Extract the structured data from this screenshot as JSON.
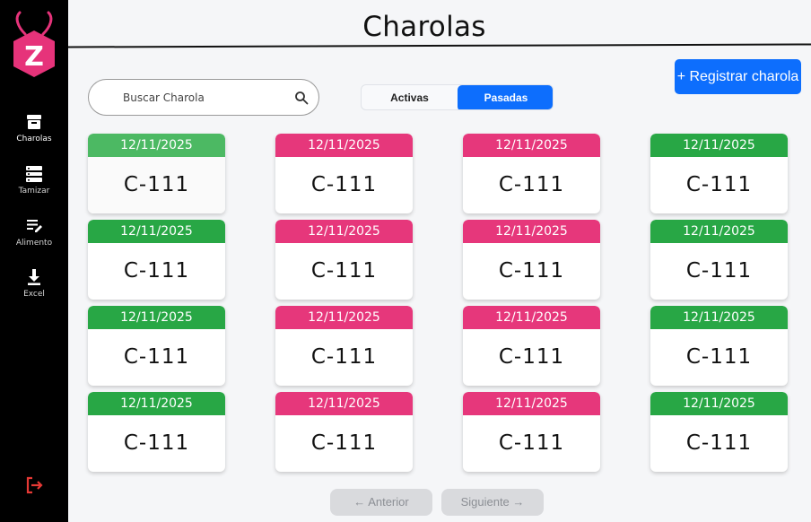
{
  "page": {
    "title": "Charolas"
  },
  "logo": {
    "letter": "Z",
    "color": "#e6337a"
  },
  "sidebar": {
    "items": [
      {
        "label": "Charolas",
        "icon": "archive-icon",
        "active": true
      },
      {
        "label": "Tamizar",
        "icon": "server-icon",
        "active": false
      },
      {
        "label": "Alimento",
        "icon": "edit-list-icon",
        "active": false
      },
      {
        "label": "Excel",
        "icon": "download-icon",
        "active": false
      }
    ],
    "logout_icon": "logout-icon",
    "logout_color": "#e53935"
  },
  "toolbar": {
    "register_label": "+ Registrar charola",
    "search_placeholder": "Buscar Charola",
    "tabs": [
      "Activas",
      "Pasadas"
    ],
    "selected_tab": "Pasadas"
  },
  "colors": {
    "green": "#28a745",
    "light_green": "#4cb963",
    "pink": "#e6377b",
    "primary": "#0d6efd"
  },
  "cards": [
    {
      "date": "12/11/2025",
      "code": "C-111",
      "status": "light-green"
    },
    {
      "date": "12/11/2025",
      "code": "C-111",
      "status": "pink"
    },
    {
      "date": "12/11/2025",
      "code": "C-111",
      "status": "pink"
    },
    {
      "date": "12/11/2025",
      "code": "C-111",
      "status": "green"
    },
    {
      "date": "12/11/2025",
      "code": "C-111",
      "status": "green"
    },
    {
      "date": "12/11/2025",
      "code": "C-111",
      "status": "pink"
    },
    {
      "date": "12/11/2025",
      "code": "C-111",
      "status": "pink"
    },
    {
      "date": "12/11/2025",
      "code": "C-111",
      "status": "green"
    },
    {
      "date": "12/11/2025",
      "code": "C-111",
      "status": "green"
    },
    {
      "date": "12/11/2025",
      "code": "C-111",
      "status": "pink"
    },
    {
      "date": "12/11/2025",
      "code": "C-111",
      "status": "pink"
    },
    {
      "date": "12/11/2025",
      "code": "C-111",
      "status": "green"
    },
    {
      "date": "12/11/2025",
      "code": "C-111",
      "status": "green"
    },
    {
      "date": "12/11/2025",
      "code": "C-111",
      "status": "pink"
    },
    {
      "date": "12/11/2025",
      "code": "C-111",
      "status": "pink"
    },
    {
      "date": "12/11/2025",
      "code": "C-111",
      "status": "green"
    }
  ],
  "pagination": {
    "prev_label": "Anterior",
    "next_label": "Siguiente"
  }
}
